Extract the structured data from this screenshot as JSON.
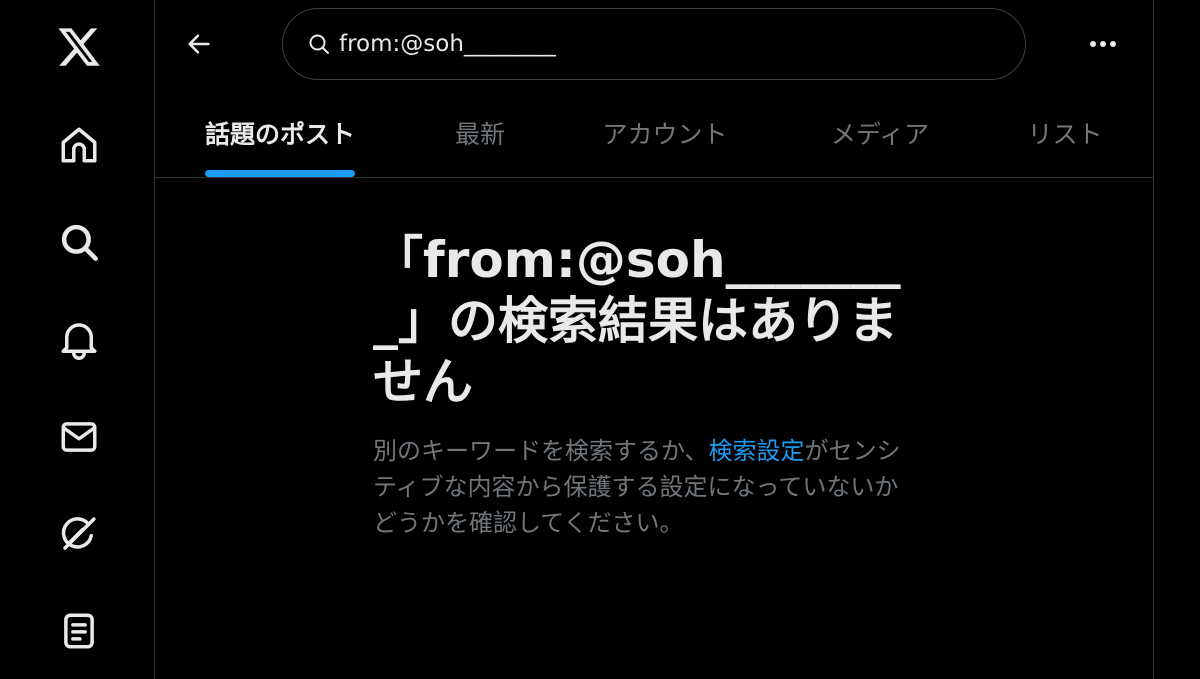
{
  "nav": {
    "items": [
      {
        "name": "x-logo-icon",
        "label": "X"
      },
      {
        "name": "home-icon",
        "label": "ホーム"
      },
      {
        "name": "search-icon",
        "label": "話題を検索"
      },
      {
        "name": "bell-icon",
        "label": "通知"
      },
      {
        "name": "mail-icon",
        "label": "メッセージ"
      },
      {
        "name": "grok-icon",
        "label": "Grok"
      },
      {
        "name": "list-icon",
        "label": "リスト"
      }
    ]
  },
  "header": {
    "search_value": "from:@soh________",
    "back_icon": "arrow-left-icon",
    "more_icon": "more-horizontal-icon"
  },
  "tabs": [
    {
      "label": "話題のポスト",
      "active": true
    },
    {
      "label": "最新",
      "active": false
    },
    {
      "label": "アカウント",
      "active": false
    },
    {
      "label": "メディア",
      "active": false
    },
    {
      "label": "リスト",
      "active": false
    }
  ],
  "empty_state": {
    "title": "「from:@soh________」の検索結果はありません",
    "desc_before": "別のキーワードを検索するか、",
    "desc_link": "検索設定",
    "desc_after": "がセンシティブな内容から保護する設定になっていないかどうかを確認してください。"
  },
  "colors": {
    "background": "#000000",
    "accent": "#1d9bf0",
    "text_primary": "#e7e9ea",
    "text_secondary": "#71767b",
    "border": "#2f3336"
  }
}
